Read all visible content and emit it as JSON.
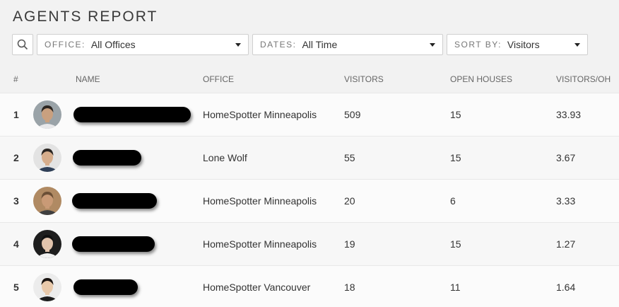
{
  "title": "AGENTS REPORT",
  "filters": {
    "office": {
      "label": "OFFICE:",
      "value": "All Offices"
    },
    "dates": {
      "label": "DATES:",
      "value": "All Time"
    },
    "sort": {
      "label": "SORT BY:",
      "value": "Visitors"
    }
  },
  "columns": {
    "rank": "#",
    "name": "NAME",
    "office": "OFFICE",
    "visitors": "VISITORS",
    "open_houses": "OPEN HOUSES",
    "visitors_oh": "VISITORS/OH"
  },
  "rows": [
    {
      "rank": "1",
      "office": "HomeSpotter Minneapolis",
      "visitors": "509",
      "open_houses": "15",
      "visitors_oh": "33.93",
      "avatar": {
        "bg": "#9aa3a8",
        "skin": "#c9a07f",
        "hair": "#2b2521",
        "shirt": "#e8e8ea"
      }
    },
    {
      "rank": "2",
      "office": "Lone Wolf",
      "visitors": "55",
      "open_houses": "15",
      "visitors_oh": "3.67",
      "avatar": {
        "bg": "#e3e3e3",
        "skin": "#d6ad8c",
        "hair": "#2a2522",
        "shirt": "#2f3f57"
      }
    },
    {
      "rank": "3",
      "office": "HomeSpotter Minneapolis",
      "visitors": "20",
      "open_houses": "6",
      "visitors_oh": "3.33",
      "avatar": {
        "bg": "#b08a63",
        "skin": "#c99a76",
        "hair": "#6b4f36",
        "shirt": "#3f3f3f"
      }
    },
    {
      "rank": "4",
      "office": "HomeSpotter Minneapolis",
      "visitors": "19",
      "open_houses": "15",
      "visitors_oh": "1.27",
      "avatar": {
        "bg": "#1e1e1e",
        "skin": "#e2c4ad",
        "hair": "#111111",
        "shirt": "#f1f1f1"
      }
    },
    {
      "rank": "5",
      "office": "HomeSpotter Vancouver",
      "visitors": "18",
      "open_houses": "11",
      "visitors_oh": "1.64",
      "avatar": {
        "bg": "#ececec",
        "skin": "#e8c9ab",
        "hair": "#1a1411",
        "shirt": "#1d1d1d"
      }
    }
  ]
}
